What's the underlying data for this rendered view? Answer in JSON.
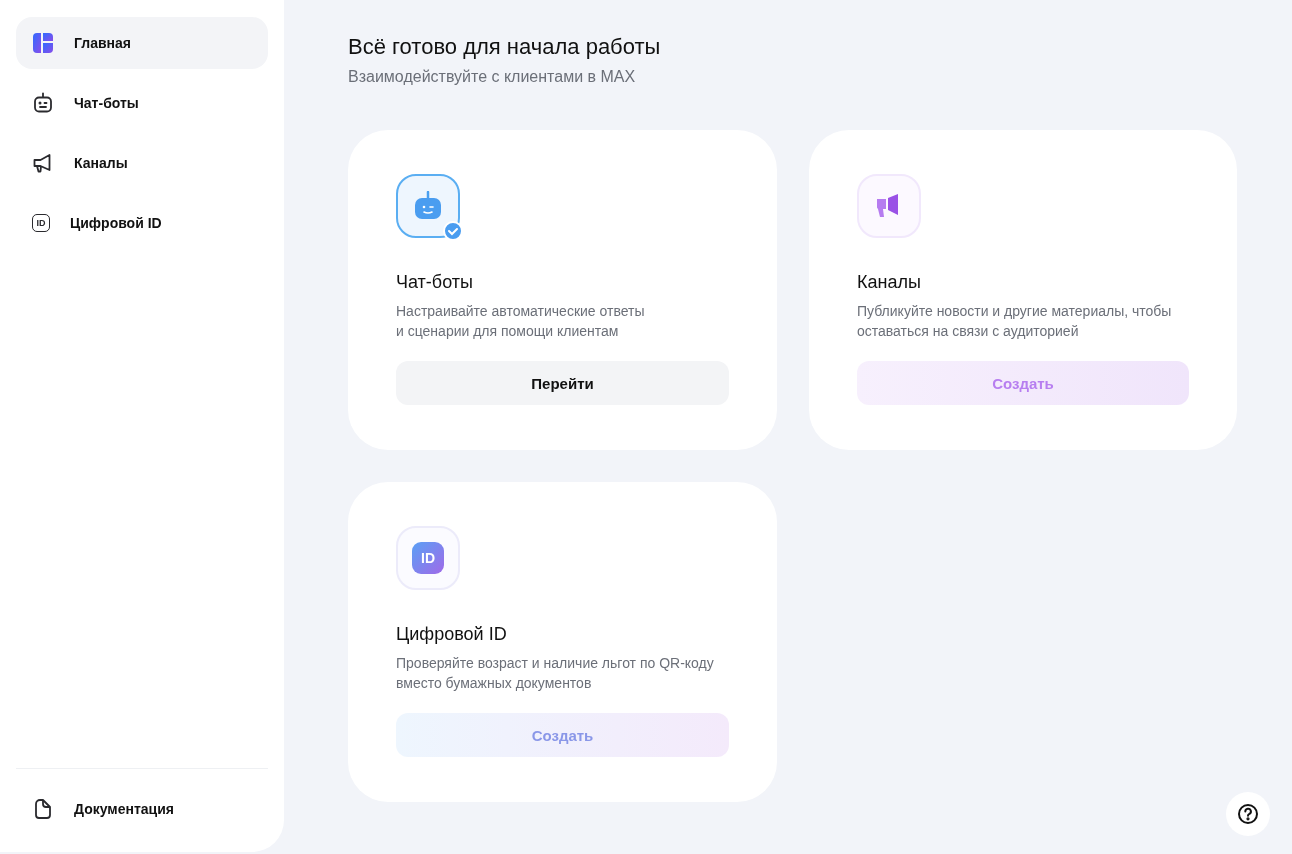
{
  "sidebar": {
    "items": [
      {
        "label": "Главная",
        "kind": "home",
        "selected": true
      },
      {
        "label": "Чат-боты",
        "kind": "bot",
        "selected": false
      },
      {
        "label": "Каналы",
        "kind": "channel",
        "selected": false
      },
      {
        "label": "Цифровой ID",
        "kind": "id",
        "icon_label": "ID",
        "selected": false
      }
    ],
    "footer_items": [
      {
        "label": "Документация",
        "kind": "doc",
        "selected": false
      }
    ]
  },
  "main": {
    "title": "Всё готово для начала работы",
    "subtitle": "Взаимодействуйте с клиентами в MAX",
    "cards": [
      {
        "kind": "bot",
        "verified": true,
        "title": "Чат-боты",
        "description": "Настраивайте автоматические ответы\nи сценарии для помощи клиентам",
        "button": {
          "label": "Перейти"
        }
      },
      {
        "kind": "channel",
        "verified": false,
        "title": "Каналы",
        "description": "Публикуйте новости и другие материалы, чтобы\nоставаться на связи с аудиторией",
        "button": {
          "label": "Создать"
        }
      },
      {
        "kind": "id",
        "icon_label": "ID",
        "verified": false,
        "title": "Цифровой ID",
        "description": "Проверяйте возраст и наличие льгот по QR-коду\nвместо бумажных документов",
        "button": {
          "label": "Создать"
        }
      }
    ]
  },
  "help_button": {
    "kind": "help"
  }
}
